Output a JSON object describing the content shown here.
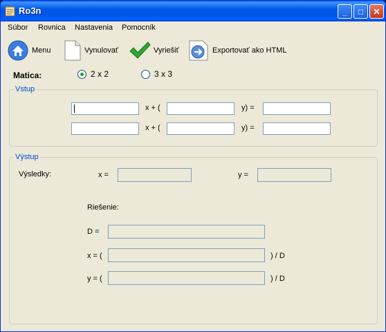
{
  "window": {
    "title": "Ro3n"
  },
  "menu": [
    "Súbor",
    "Rovnica",
    "Nastavenia",
    "Pomocník"
  ],
  "toolbar": {
    "menu": "Menu",
    "reset": "Vynulovať",
    "solve": "Vyriešiť",
    "export": "Exportovať ako HTML"
  },
  "matrix": {
    "label": "Matica:",
    "options": [
      "2 x 2",
      "3 x 3"
    ],
    "selected": "2 x 2"
  },
  "input_group": {
    "legend": "Vstup",
    "x_op": "x + (",
    "y_op": "y) ="
  },
  "output_group": {
    "legend": "Výstup",
    "results_label": "Výsledky:",
    "x_label": "x =",
    "y_label": "y =",
    "solution_label": "Riešenie:",
    "d_label": "D =",
    "x_paren": "x = (",
    "y_paren": "y = (",
    "div_d": ") / D"
  },
  "colors": {
    "accent": "#0046d5",
    "window_bg": "#ece9d8"
  }
}
